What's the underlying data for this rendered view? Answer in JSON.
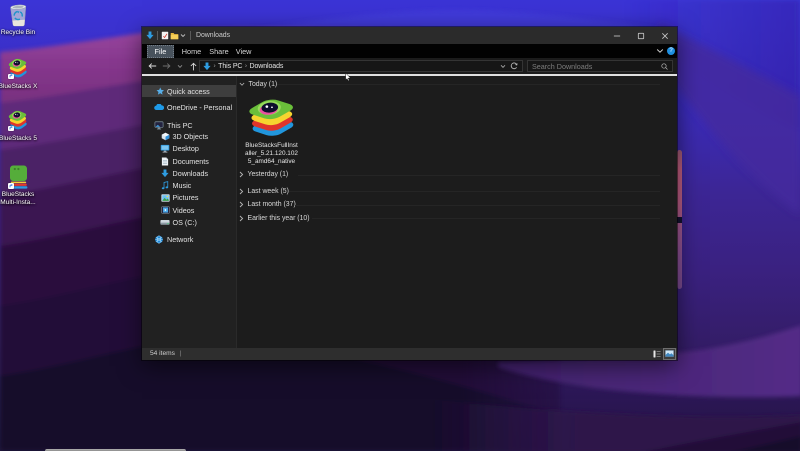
{
  "desktop": {
    "icons": [
      {
        "label1": "Recycle Bin",
        "label2": "",
        "icon": "recycle-bin"
      },
      {
        "label1": "BlueStacks X",
        "label2": "",
        "icon": "bluestacks-stack"
      },
      {
        "label1": "BlueStacks 5",
        "label2": "",
        "icon": "bluestacks-stack"
      },
      {
        "label1": "BlueStacks",
        "label2": "Multi-Insta...",
        "icon": "bluestacks-multi"
      }
    ]
  },
  "window": {
    "title": "Downloads",
    "controls": {
      "minimize": "minimize",
      "maximize": "maximize",
      "close": "close"
    },
    "menu": {
      "tabs": [
        "File",
        "Home",
        "Share",
        "View"
      ],
      "active_tab": "File",
      "help": "?"
    },
    "toolbar": {
      "breadcrumb_root": "This PC",
      "breadcrumb_current": "Downloads",
      "search_placeholder": "Search Downloads"
    },
    "nav": {
      "items": [
        {
          "label": "Quick access",
          "icon": "star",
          "selected": true
        },
        {
          "label": "OneDrive - Personal",
          "icon": "cloud"
        },
        {
          "label": "This PC",
          "icon": "pc"
        },
        {
          "label": "3D Objects",
          "icon": "cube",
          "child": true
        },
        {
          "label": "Desktop",
          "icon": "monitor",
          "child": true
        },
        {
          "label": "Documents",
          "icon": "document",
          "child": true
        },
        {
          "label": "Downloads",
          "icon": "download",
          "child": true
        },
        {
          "label": "Music",
          "icon": "note",
          "child": true
        },
        {
          "label": "Pictures",
          "icon": "picture",
          "child": true
        },
        {
          "label": "Videos",
          "icon": "video",
          "child": true
        },
        {
          "label": "OS (C:)",
          "icon": "drive",
          "child": true
        },
        {
          "label": "Network",
          "icon": "network"
        }
      ]
    },
    "content": {
      "groups": [
        {
          "label": "Today (1)",
          "expanded": true
        },
        {
          "label": "Yesterday (1)",
          "expanded": false
        },
        {
          "label": "Last week (5)",
          "expanded": false
        },
        {
          "label": "Last month (37)",
          "expanded": false
        },
        {
          "label": "Earlier this year (10)",
          "expanded": false
        }
      ],
      "file": {
        "name_line1": "BlueStacksFullInst",
        "name_line2": "aller_5.21.120.102",
        "name_line3": "5_amd64_native"
      }
    },
    "status": {
      "items_count": "54 items",
      "separator": "|"
    }
  },
  "colors": {
    "accent_blue": "#2e9ce0",
    "wallpaper_blue": "#3b35d8",
    "wallpaper_magenta": "#8a3b92",
    "file_tab": "#48525c"
  }
}
